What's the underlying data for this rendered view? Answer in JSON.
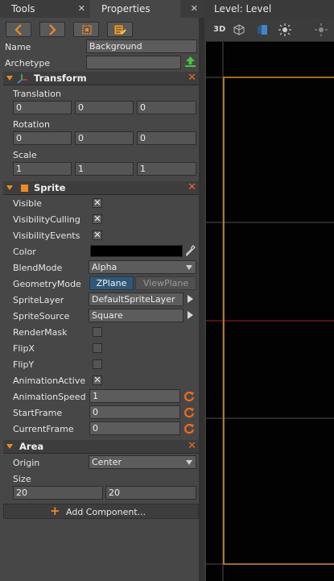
{
  "tabs": [
    {
      "label": "Tools",
      "close": "✕"
    },
    {
      "label": "Properties",
      "close": "✕"
    },
    {
      "label": "",
      "close": "✕"
    },
    {
      "label": "Level: Level"
    }
  ],
  "viewport_toolbar": {
    "mode_3d": "3D"
  },
  "object": {
    "name_label": "Name",
    "name_value": "Background",
    "archetype_label": "Archetype",
    "archetype_value": ""
  },
  "transform": {
    "title": "Transform",
    "translation_label": "Translation",
    "translation": [
      "0",
      "0",
      "0"
    ],
    "rotation_label": "Rotation",
    "rotation": [
      "0",
      "0",
      "0"
    ],
    "scale_label": "Scale",
    "scale": [
      "1",
      "1",
      "1"
    ]
  },
  "sprite": {
    "title": "Sprite",
    "visible_label": "Visible",
    "visible": true,
    "vis_culling_label": "VisibilityCulling",
    "vis_culling": true,
    "vis_events_label": "VisibilityEvents",
    "vis_events": true,
    "color_label": "Color",
    "color": "#000000",
    "blendmode_label": "BlendMode",
    "blendmode": "Alpha",
    "geometry_label": "GeometryMode",
    "geometry_options": [
      "ZPlane",
      "ViewPlane"
    ],
    "geometry_selected": "ZPlane",
    "spritelayer_label": "SpriteLayer",
    "spritelayer": "DefaultSpriteLayer",
    "spritesource_label": "SpriteSource",
    "spritesource": "Square",
    "rendermask_label": "RenderMask",
    "flipx_label": "FlipX",
    "flipy_label": "FlipY",
    "anim_active_label": "AnimationActive",
    "anim_active": true,
    "anim_speed_label": "AnimationSpeed",
    "anim_speed": "1",
    "start_frame_label": "StartFrame",
    "start_frame": "0",
    "current_frame_label": "CurrentFrame",
    "current_frame": "0"
  },
  "area": {
    "title": "Area",
    "origin_label": "Origin",
    "origin": "Center",
    "size_label": "Size",
    "size": [
      "20",
      "20"
    ]
  },
  "add_component_label": "Add Component...",
  "colors": {
    "accent": "#f08a1e",
    "selected": "#2f5878",
    "grid_line": "#5a5a5a",
    "level_border": "#d89020",
    "axis_red": "#a02020"
  }
}
